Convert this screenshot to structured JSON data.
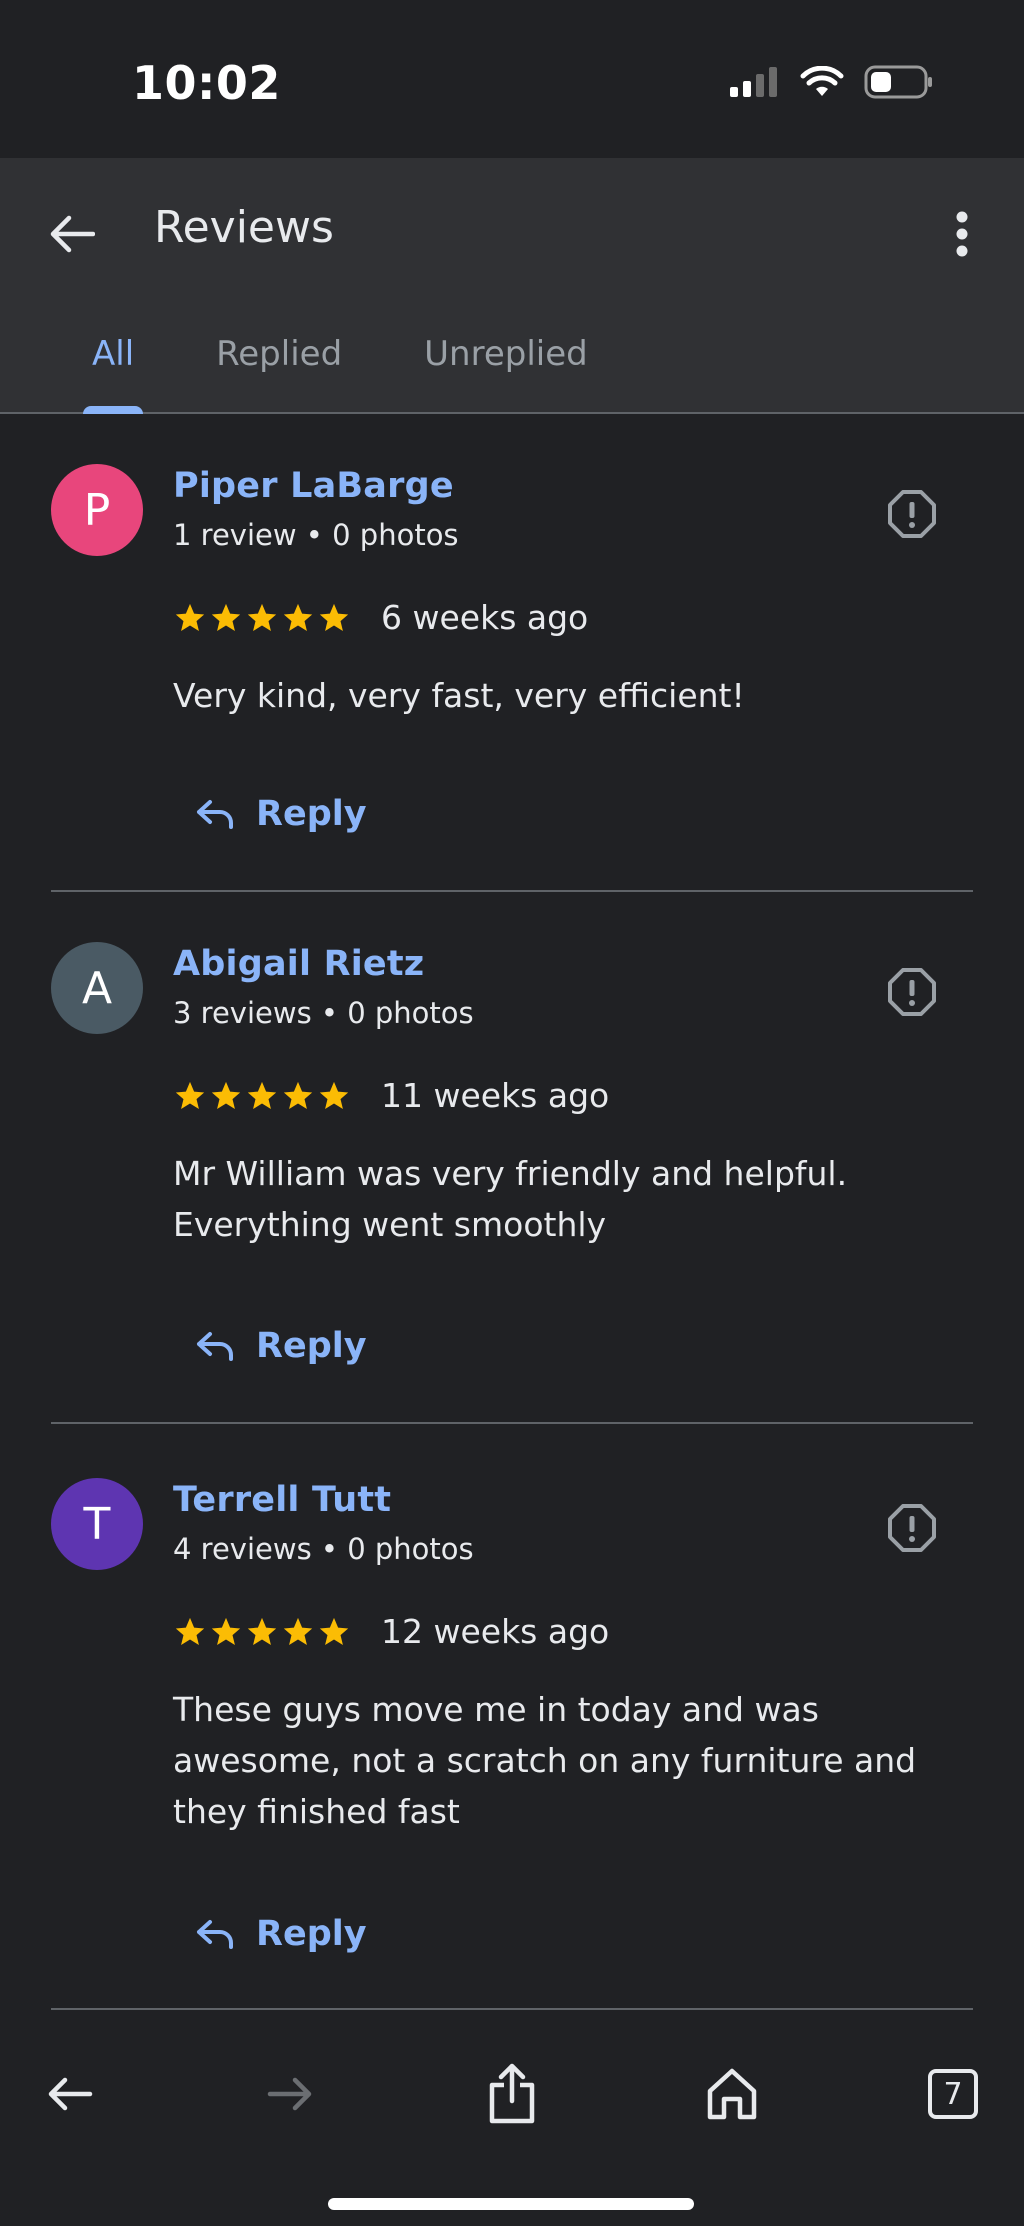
{
  "status_bar": {
    "time": "10:02"
  },
  "app_bar": {
    "title": "Reviews",
    "back_icon": "arrow-left-icon",
    "more_icon": "more-vert-icon"
  },
  "tabs": [
    {
      "label": "All",
      "active": true
    },
    {
      "label": "Replied",
      "active": false
    },
    {
      "label": "Unreplied",
      "active": false
    }
  ],
  "reviews": [
    {
      "initial": "P",
      "avatar_color": "#e8467c",
      "name": "Piper LaBarge",
      "meta": "1 review • 0 photos",
      "stars": 5,
      "date": "6 weeks ago",
      "text": "Very kind, very fast, very efficient!",
      "reply_label": "Reply"
    },
    {
      "initial": "A",
      "avatar_color": "#4a5a64",
      "name": "Abigail Rietz",
      "meta": "3 reviews • 0 photos",
      "stars": 5,
      "date": "11 weeks ago",
      "text": "Mr William was very friendly and helpful. Everything went smoothly",
      "reply_label": "Reply"
    },
    {
      "initial": "T",
      "avatar_color": "#5e35b1",
      "name": "Terrell Tutt",
      "meta": "4 reviews • 0 photos",
      "stars": 5,
      "date": "12 weeks ago",
      "text": "These guys move me in today and was awesome, not a scratch on any furniture and they finished fast",
      "reply_label": "Reply"
    }
  ],
  "colors": {
    "accent": "#8ab4f8",
    "star": "#fbbc04",
    "background": "#202124",
    "app_bar": "#303134"
  },
  "bottom_nav": {
    "tab_count": "7",
    "icons": [
      "arrow-left-icon",
      "arrow-right-icon",
      "share-icon",
      "home-icon",
      "tabs-icon"
    ]
  }
}
